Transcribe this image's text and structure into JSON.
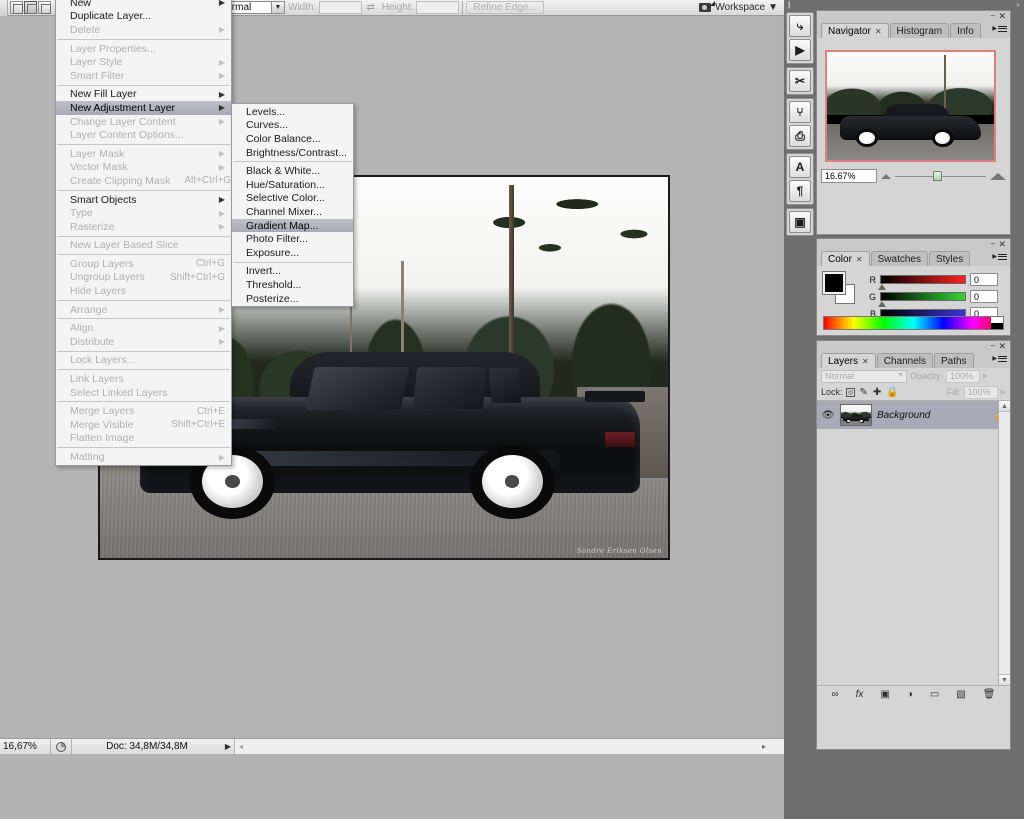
{
  "options_bar": {
    "tool_presets": [
      "preset-icon-1",
      "preset-icon-2",
      "preset-icon-3"
    ],
    "mode_select_value": "Normal",
    "width_label": "Width:",
    "width_value": "",
    "height_label": "Height:",
    "height_value": "",
    "swap_icon": "⇄",
    "refine_edge_label": "Refine Edge...",
    "workspace_label": "Workspace",
    "workspace_chevron": "▼",
    "camera_icon": "bridge-icon"
  },
  "layer_menu": {
    "items": [
      {
        "label": "New",
        "submenu": true,
        "enabled": true,
        "shortcut": ""
      },
      {
        "label": "Duplicate Layer...",
        "submenu": false,
        "enabled": true,
        "shortcut": ""
      },
      {
        "label": "Delete",
        "submenu": true,
        "enabled": false,
        "shortcut": ""
      },
      {
        "separator": true
      },
      {
        "label": "Layer Properties...",
        "submenu": false,
        "enabled": false,
        "shortcut": ""
      },
      {
        "label": "Layer Style",
        "submenu": true,
        "enabled": false,
        "shortcut": ""
      },
      {
        "label": "Smart Filter",
        "submenu": true,
        "enabled": false,
        "shortcut": ""
      },
      {
        "separator": true
      },
      {
        "label": "New Fill Layer",
        "submenu": true,
        "enabled": true,
        "shortcut": ""
      },
      {
        "label": "New Adjustment Layer",
        "submenu": true,
        "enabled": true,
        "shortcut": "",
        "highlighted": true
      },
      {
        "label": "Change Layer Content",
        "submenu": true,
        "enabled": false,
        "shortcut": ""
      },
      {
        "label": "Layer Content Options...",
        "submenu": false,
        "enabled": false,
        "shortcut": ""
      },
      {
        "separator": true
      },
      {
        "label": "Layer Mask",
        "submenu": true,
        "enabled": false,
        "shortcut": ""
      },
      {
        "label": "Vector Mask",
        "submenu": true,
        "enabled": false,
        "shortcut": ""
      },
      {
        "label": "Create Clipping Mask",
        "submenu": false,
        "enabled": false,
        "shortcut": "Alt+Ctrl+G"
      },
      {
        "separator": true
      },
      {
        "label": "Smart Objects",
        "submenu": true,
        "enabled": true,
        "shortcut": ""
      },
      {
        "label": "Type",
        "submenu": true,
        "enabled": false,
        "shortcut": ""
      },
      {
        "label": "Rasterize",
        "submenu": true,
        "enabled": false,
        "shortcut": ""
      },
      {
        "separator": true
      },
      {
        "label": "New Layer Based Slice",
        "submenu": false,
        "enabled": false,
        "shortcut": ""
      },
      {
        "separator": true
      },
      {
        "label": "Group Layers",
        "submenu": false,
        "enabled": false,
        "shortcut": "Ctrl+G"
      },
      {
        "label": "Ungroup Layers",
        "submenu": false,
        "enabled": false,
        "shortcut": "Shift+Ctrl+G"
      },
      {
        "label": "Hide Layers",
        "submenu": false,
        "enabled": false,
        "shortcut": ""
      },
      {
        "separator": true
      },
      {
        "label": "Arrange",
        "submenu": true,
        "enabled": false,
        "shortcut": ""
      },
      {
        "separator": true
      },
      {
        "label": "Align",
        "submenu": true,
        "enabled": false,
        "shortcut": ""
      },
      {
        "label": "Distribute",
        "submenu": true,
        "enabled": false,
        "shortcut": ""
      },
      {
        "separator": true
      },
      {
        "label": "Lock Layers...",
        "submenu": false,
        "enabled": false,
        "shortcut": ""
      },
      {
        "separator": true
      },
      {
        "label": "Link Layers",
        "submenu": false,
        "enabled": false,
        "shortcut": ""
      },
      {
        "label": "Select Linked Layers",
        "submenu": false,
        "enabled": false,
        "shortcut": ""
      },
      {
        "separator": true
      },
      {
        "label": "Merge Layers",
        "submenu": false,
        "enabled": false,
        "shortcut": "Ctrl+E"
      },
      {
        "label": "Merge Visible",
        "submenu": false,
        "enabled": false,
        "shortcut": "Shift+Ctrl+E"
      },
      {
        "label": "Flatten Image",
        "submenu": false,
        "enabled": false,
        "shortcut": ""
      },
      {
        "separator": true
      },
      {
        "label": "Matting",
        "submenu": true,
        "enabled": false,
        "shortcut": ""
      }
    ]
  },
  "adjustment_submenu": {
    "items": [
      {
        "label": "Levels...",
        "enabled": true
      },
      {
        "label": "Curves...",
        "enabled": true
      },
      {
        "label": "Color Balance...",
        "enabled": true
      },
      {
        "label": "Brightness/Contrast...",
        "enabled": true
      },
      {
        "separator": true
      },
      {
        "label": "Black & White...",
        "enabled": true
      },
      {
        "label": "Hue/Saturation...",
        "enabled": true
      },
      {
        "label": "Selective Color...",
        "enabled": true
      },
      {
        "label": "Channel Mixer...",
        "enabled": true
      },
      {
        "label": "Gradient Map...",
        "enabled": true,
        "highlighted": true
      },
      {
        "label": "Photo Filter...",
        "enabled": true
      },
      {
        "label": "Exposure...",
        "enabled": true
      },
      {
        "separator": true
      },
      {
        "label": "Invert...",
        "enabled": true
      },
      {
        "label": "Threshold...",
        "enabled": true
      },
      {
        "label": "Posterize...",
        "enabled": true
      }
    ]
  },
  "canvas": {
    "image_alt": "black-bmw-e36-coupe-on-gravel-road",
    "watermark": "Sondre Eriksen Olsen"
  },
  "status_bar": {
    "zoom": "16,67%",
    "doc_info": "Doc: 34,8M/34,8M",
    "play_triangle": "▶",
    "left_arrow": "◂",
    "right_arrow": "▸"
  },
  "dock": {
    "grip": "||",
    "collapse_chevron": "»",
    "icon_rail": [
      {
        "name": "history-icon",
        "glyph": "⤷"
      },
      {
        "name": "actions-icon",
        "glyph": "▶"
      },
      {
        "name": "tool-presets-icon",
        "glyph": "✂"
      },
      {
        "name": "brushes-icon",
        "glyph": "⑂"
      },
      {
        "name": "clone-source-icon",
        "glyph": "⎙"
      },
      {
        "name": "character-icon",
        "glyph": "A"
      },
      {
        "name": "paragraph-icon",
        "glyph": "¶"
      },
      {
        "name": "layer-comps-icon",
        "glyph": "▣"
      }
    ]
  },
  "navigator_panel": {
    "tabs": [
      {
        "label": "Navigator",
        "active": true,
        "closable": true
      },
      {
        "label": "Histogram",
        "active": false,
        "closable": false
      },
      {
        "label": "Info",
        "active": false,
        "closable": false
      }
    ],
    "minimize": "–",
    "close": "✕",
    "zoom_value": "16.67%",
    "zoom_out_icon": "small-mountain-icon",
    "zoom_in_icon": "large-mountain-icon",
    "view_box_color": "#e07f7f"
  },
  "color_panel": {
    "tabs": [
      {
        "label": "Color",
        "active": true,
        "closable": true
      },
      {
        "label": "Swatches",
        "active": false,
        "closable": false
      },
      {
        "label": "Styles",
        "active": false,
        "closable": false
      }
    ],
    "minimize": "–",
    "close": "✕",
    "foreground_color": "#000000",
    "background_color": "#ffffff",
    "channels": [
      {
        "label": "R",
        "value": "0"
      },
      {
        "label": "G",
        "value": "0"
      },
      {
        "label": "B",
        "value": "0"
      }
    ]
  },
  "layers_panel": {
    "tabs": [
      {
        "label": "Layers",
        "active": true,
        "closable": true
      },
      {
        "label": "Channels",
        "active": false,
        "closable": false
      },
      {
        "label": "Paths",
        "active": false,
        "closable": false
      }
    ],
    "minimize": "–",
    "close": "✕",
    "blend_mode": "Normal",
    "opacity_label": "Opacity:",
    "opacity_value": "100%",
    "lock_label": "Lock:",
    "lock_icons": [
      {
        "name": "lock-transparency-icon",
        "glyph": "▣"
      },
      {
        "name": "lock-image-icon",
        "glyph": "✐"
      },
      {
        "name": "lock-position-icon",
        "glyph": "✚"
      },
      {
        "name": "lock-all-icon",
        "glyph": "🔒"
      }
    ],
    "fill_label": "Fill:",
    "fill_value": "100%",
    "layers": [
      {
        "name": "Background",
        "visible": true,
        "locked": true,
        "selected": true
      }
    ],
    "footer_icons": [
      {
        "name": "link-layers-icon",
        "glyph": "∞"
      },
      {
        "name": "layer-style-icon",
        "glyph": "fx"
      },
      {
        "name": "layer-mask-icon",
        "glyph": "▣"
      },
      {
        "name": "adjustment-layer-icon",
        "glyph": "◑"
      },
      {
        "name": "new-group-icon",
        "glyph": "▭"
      },
      {
        "name": "new-layer-icon",
        "glyph": "▧"
      },
      {
        "name": "delete-layer-icon",
        "glyph": "🗑"
      }
    ]
  }
}
